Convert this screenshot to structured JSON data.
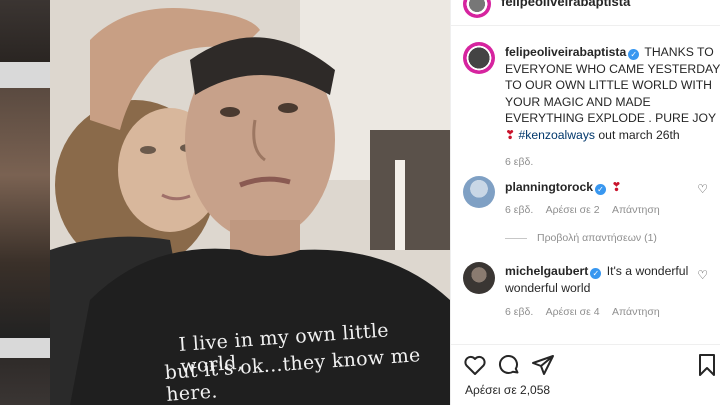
{
  "post": {
    "username": "felipeoliveirabaptista",
    "caption": {
      "text": "THANKS TO EVERYONE WHO CAME YESTERDAY TO OUR OWN LITTLE WORLD WITH YOUR MAGIC AND MADE EVERYTHING EXPLODE . PURE JOY",
      "hashtag": "#kenzoalways",
      "suffix": "out march 26th",
      "emoji": "❣"
    },
    "time": "6 εβδ.",
    "shirt_text_line1": "I live in my own little world,",
    "shirt_text_line2": "but it's ok...they know me here."
  },
  "comments": [
    {
      "username": "planningtorock",
      "text": "❣",
      "time": "6 εβδ.",
      "likes": "Αρέσει σε 2",
      "reply": "Απάντηση",
      "view_replies": "Προβολή απαντήσεων (1)"
    },
    {
      "username": "michelgaubert",
      "text": "It's a wonderful wonderful world",
      "time": "6 εβδ.",
      "likes": "Αρέσει σε 4",
      "reply": "Απάντηση"
    }
  ],
  "actions": {
    "like_count": "Αρέσει σε 2,058"
  },
  "icons": {
    "like": "heart-outline-icon",
    "comment": "comment-bubble-icon",
    "share": "paper-plane-icon",
    "save": "bookmark-icon",
    "verified": "verified-badge-icon"
  },
  "colors": {
    "verified": "#3897f0",
    "hashtag": "#00376b",
    "secondary_text": "#8e8e8e"
  }
}
